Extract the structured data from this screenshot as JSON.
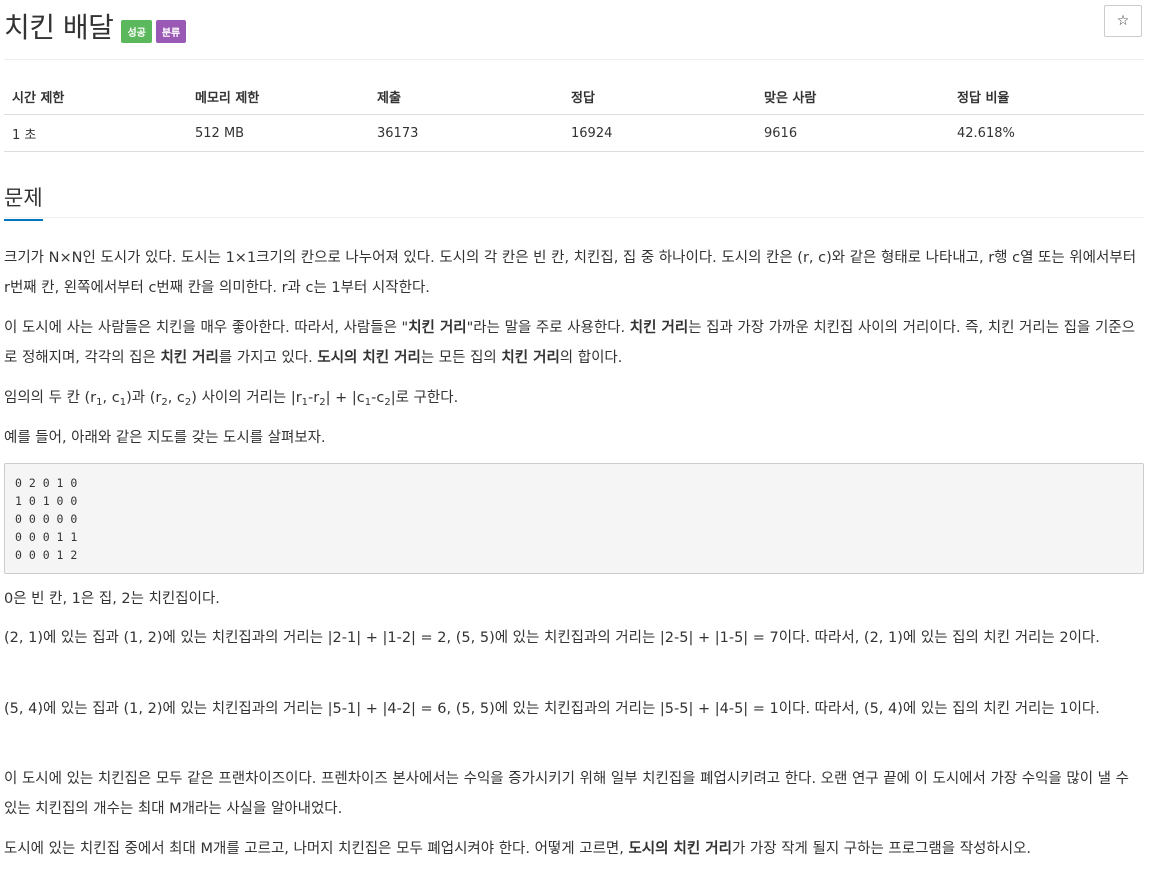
{
  "problem": {
    "title": "치킨 배달",
    "badges": {
      "success": "성공",
      "classification": "분류"
    },
    "star": "☆"
  },
  "info_table": {
    "headers": [
      "시간 제한",
      "메모리 제한",
      "제출",
      "정답",
      "맞은 사람",
      "정답 비율"
    ],
    "values": [
      "1 초",
      "512 MB",
      "36173",
      "16924",
      "9616",
      "42.618%"
    ]
  },
  "section": {
    "title": "문제"
  },
  "text": {
    "p1": "크기가 N×N인 도시가 있다. 도시는 1×1크기의 칸으로 나누어져 있다. 도시의 각 칸은 빈 칸, 치킨집, 집 중 하나이다. 도시의 칸은 (r, c)와 같은 형태로 나타내고, r행 c열 또는 위에서부터 r번째 칸, 왼쪽에서부터 c번째 칸을 의미한다. r과 c는 1부터 시작한다.",
    "p2_a": "이 도시에 사는 사람들은 치킨을 매우 좋아한다. 따라서, 사람들은 \"",
    "p2_b": "치킨 거리",
    "p2_c": "\"라는 말을 주로 사용한다. ",
    "p2_d": "치킨 거리",
    "p2_e": "는 집과 가장 가까운 치킨집 사이의 거리이다. 즉, 치킨 거리는 집을 기준으로 정해지며, 각각의 집은 ",
    "p2_f": "치킨 거리",
    "p2_g": "를 가지고 있다. ",
    "p2_h": "도시의 치킨 거리",
    "p2_i": "는 모든 집의 ",
    "p2_j": "치킨 거리",
    "p2_k": "의 합이다.",
    "p3": {
      "t1": "임의의 두 칸 (r",
      "s1": "1",
      "t2": ", c",
      "s2": "1",
      "t3": ")과 (r",
      "s3": "2",
      "t4": ", c",
      "s4": "2",
      "t5": ") 사이의 거리는 |r",
      "s5": "1",
      "t6": "-r",
      "s6": "2",
      "t7": "| + |c",
      "s7": "1",
      "t8": "-c",
      "s8": "2",
      "t9": "|로 구한다."
    },
    "p4": "예를 들어, 아래와 같은 지도를 갖는 도시를 살펴보자.",
    "grid": "0 2 0 1 0\n1 0 1 0 0\n0 0 0 0 0\n0 0 0 1 1\n0 0 0 1 2",
    "p5": "0은 빈 칸, 1은 집, 2는 치킨집이다.",
    "p6": "(2, 1)에 있는 집과 (1, 2)에 있는 치킨집과의 거리는 |2-1| + |1-2| = 2, (5, 5)에 있는 치킨집과의 거리는 |2-5| + |1-5| = 7이다. 따라서, (2, 1)에 있는 집의 치킨 거리는 2이다.",
    "p7": "(5, 4)에 있는 집과 (1, 2)에 있는 치킨집과의 거리는 |5-1| + |4-2| = 6, (5, 5)에 있는 치킨집과의 거리는 |5-5| + |4-5| = 1이다. 따라서, (5, 4)에 있는 집의 치킨 거리는 1이다.",
    "p8": "이 도시에 있는 치킨집은 모두 같은 프랜차이즈이다. 프렌차이즈 본사에서는 수익을 증가시키기 위해 일부 치킨집을 폐업시키려고 한다. 오랜 연구 끝에 이 도시에서 가장 수익을 많이 낼 수 있는  치킨집의 개수는 최대 M개라는 사실을 알아내었다.",
    "p9_a": "도시에 있는 치킨집 중에서 최대 M개를 고르고, 나머지 치킨집은 모두 폐업시켜야 한다. 어떻게 고르면, ",
    "p9_b": "도시의 치킨 거리",
    "p9_c": "가 가장 작게 될지 구하는 프로그램을 작성하시오."
  }
}
